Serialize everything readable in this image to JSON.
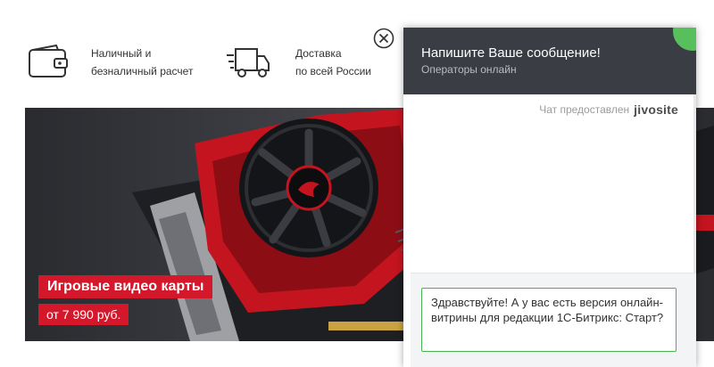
{
  "features": {
    "payment": {
      "icon": "wallet-icon",
      "text": "Наличный и\nбезналичный расчет"
    },
    "delivery": {
      "icon": "truck-icon",
      "text": "Доставка\nпо всей России"
    }
  },
  "banner": {
    "title": "Игровые видео карты",
    "price": "от 7 990 руб.",
    "image": "graphics-card-image"
  },
  "chat": {
    "header_title": "Напишите Ваше сообщение!",
    "header_subtitle": "Операторы онлайн",
    "powered_by": "Чат предоставлен",
    "brand": "jivosite",
    "message": "Здравствуйте! А у вас есть версия онлайн-витрины для редакции 1С-Битрикс: Старт?",
    "status_color": "#57c05d",
    "input_border_color": "#47b54f"
  },
  "colors": {
    "accent_red": "#d4182b",
    "chat_header": "#3b3d45"
  }
}
